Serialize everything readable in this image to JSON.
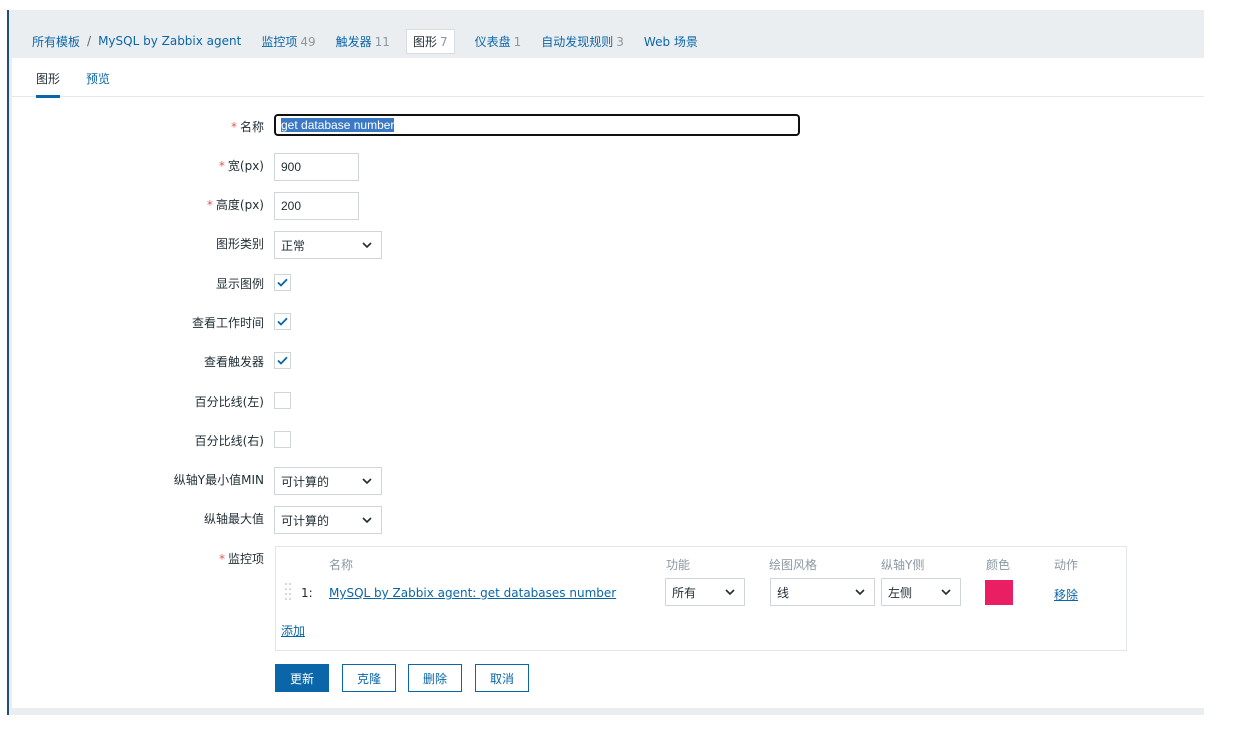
{
  "breadcrumb": {
    "root": "所有模板",
    "separator": "/",
    "template": "MySQL by Zabbix agent",
    "tabs": [
      {
        "label": "监控项",
        "count": "49"
      },
      {
        "label": "触发器",
        "count": "11"
      },
      {
        "label": "图形",
        "count": "7"
      },
      {
        "label": "仪表盘",
        "count": "1"
      },
      {
        "label": "自动发现规则",
        "count": "3"
      },
      {
        "label": "Web 场景",
        "count": ""
      }
    ]
  },
  "subtabs": {
    "graph": "图形",
    "preview": "预览"
  },
  "form": {
    "required_mark": "*",
    "name": {
      "label": "名称",
      "value": "get database number"
    },
    "width": {
      "label": "宽(px)",
      "value": "900"
    },
    "height": {
      "label": "高度(px)",
      "value": "200"
    },
    "graph_type": {
      "label": "图形类别",
      "value": "正常"
    },
    "show_legend": {
      "label": "显示图例",
      "checked": true
    },
    "show_work_period": {
      "label": "查看工作时间",
      "checked": true
    },
    "show_triggers": {
      "label": "查看触发器",
      "checked": true
    },
    "percentile_left": {
      "label": "百分比线(左)",
      "checked": false
    },
    "percentile_right": {
      "label": "百分比线(右)",
      "checked": false
    },
    "y_min": {
      "label": "纵轴Y最小值MIN",
      "value": "可计算的"
    },
    "y_max": {
      "label": "纵轴最大值",
      "value": "可计算的"
    },
    "items": {
      "label": "监控项",
      "headers": {
        "name": "名称",
        "function": "功能",
        "draw_style": "绘图风格",
        "y_axis_side": "纵轴Y侧",
        "color": "颜色",
        "action": "动作"
      },
      "rows": [
        {
          "index": "1:",
          "name": "MySQL by Zabbix agent: get databases number",
          "function": "所有",
          "draw_style": "线",
          "y_axis_side": "左侧",
          "color": "#e91e63",
          "action": "移除"
        }
      ],
      "add": "添加"
    }
  },
  "buttons": {
    "update": "更新",
    "clone": "克隆",
    "delete": "删除",
    "cancel": "取消"
  }
}
